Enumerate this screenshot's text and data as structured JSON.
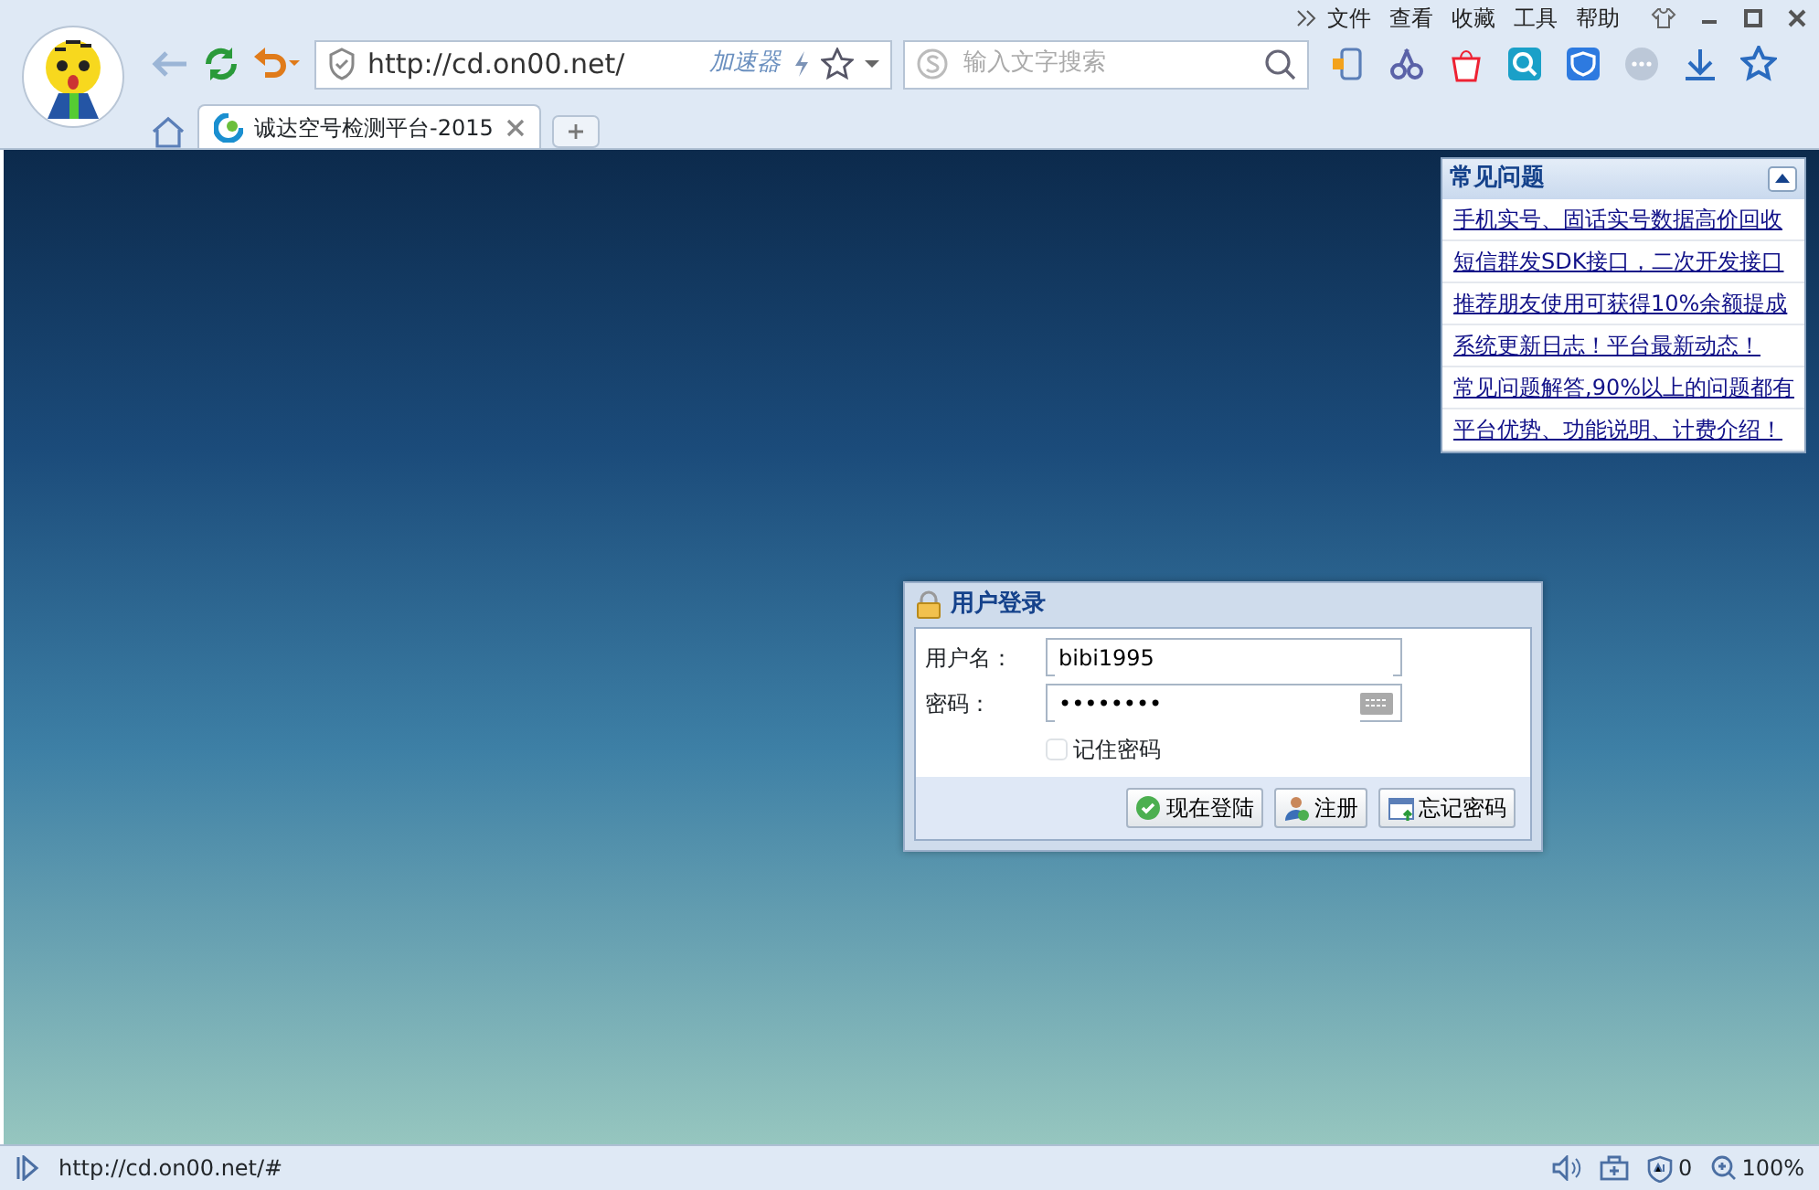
{
  "browser": {
    "menu": [
      "文件",
      "查看",
      "收藏",
      "工具",
      "帮助"
    ],
    "address": "http://cd.on00.net/",
    "accelerator": "加速器",
    "search_placeholder": "输入文字搜索",
    "tabs": [
      {
        "title": "诚达空号检测平台-2015",
        "selected": true
      }
    ]
  },
  "faq": {
    "title": "常见问题",
    "expanded": true,
    "links": [
      "手机实号、固话实号数据高价回收",
      "短信群发SDK接口，二次开发接口",
      "推荐朋友使用可获得10%余额提成",
      "系统更新日志！平台最新动态！",
      "常见问题解答,90%以上的问题都有",
      "平台优势、功能说明、计费介绍！"
    ]
  },
  "login": {
    "title": "用户登录",
    "fields": [
      {
        "label": "用户名：",
        "value": "bibi1995",
        "kind": "text"
      },
      {
        "label": "密码：",
        "value": "••••••••",
        "kind": "password"
      }
    ],
    "remember": {
      "label": "记住密码",
      "checked": false
    },
    "buttons": [
      {
        "label": "现在登陆",
        "kind": "login"
      },
      {
        "label": "注册",
        "kind": "register"
      },
      {
        "label": "忘记密码",
        "kind": "forgot"
      }
    ]
  },
  "status_bar": {
    "url": "http://cd.on00.net/#",
    "blocked": "0",
    "zoom": "100%"
  }
}
